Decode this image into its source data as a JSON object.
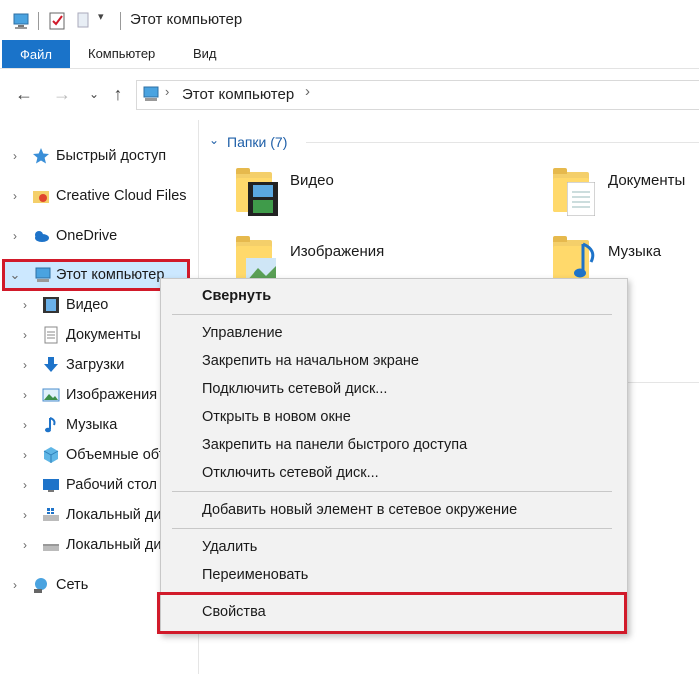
{
  "window": {
    "title": "Этот компьютер"
  },
  "ribbon": {
    "tabs": [
      "Файл",
      "Компьютер",
      "Вид"
    ]
  },
  "address": {
    "path": "Этот компьютер"
  },
  "nav": {
    "items": [
      {
        "label": "Быстрый доступ",
        "icon": "star-icon"
      },
      {
        "label": "Creative Cloud Files",
        "icon": "creative-cloud-icon"
      },
      {
        "label": "OneDrive",
        "icon": "cloud-icon"
      },
      {
        "label": "Этот компьютер",
        "icon": "computer-icon",
        "expanded": true,
        "selected": true
      },
      {
        "label": "Видео",
        "icon": "video-icon"
      },
      {
        "label": "Документы",
        "icon": "documents-icon"
      },
      {
        "label": "Загрузки",
        "icon": "download-icon"
      },
      {
        "label": "Изображения",
        "icon": "pictures-icon"
      },
      {
        "label": "Музыка",
        "icon": "music-icon"
      },
      {
        "label": "Объемные объекты",
        "icon": "cube-icon"
      },
      {
        "label": "Рабочий стол",
        "icon": "desktop-icon"
      },
      {
        "label": "Локальный диск",
        "icon": "drive-icon"
      },
      {
        "label": "Локальный диск",
        "icon": "drive-icon"
      },
      {
        "label": "Сеть",
        "icon": "network-icon"
      }
    ]
  },
  "content": {
    "group_header": "Папки (7)",
    "folders": [
      {
        "label": "Видео",
        "icon": "video-folder-icon"
      },
      {
        "label": "Документы",
        "icon": "documents-folder-icon"
      },
      {
        "label": "Изображения",
        "icon": "pictures-folder-icon"
      },
      {
        "label": "Музыка",
        "icon": "music-folder-icon"
      }
    ]
  },
  "context_menu": {
    "items": [
      "Свернуть",
      "Управление",
      "Закрепить на начальном экране",
      "Подключить сетевой диск...",
      "Открыть в новом окне",
      "Закрепить на панели быстрого доступа",
      "Отключить сетевой диск...",
      "Добавить новый элемент в сетевое окружение",
      "Удалить",
      "Переименовать",
      "Свойства"
    ]
  },
  "colors": {
    "highlight_red": "#d11a2a",
    "accent_blue": "#1a73c9",
    "selection": "#cce8ff"
  }
}
